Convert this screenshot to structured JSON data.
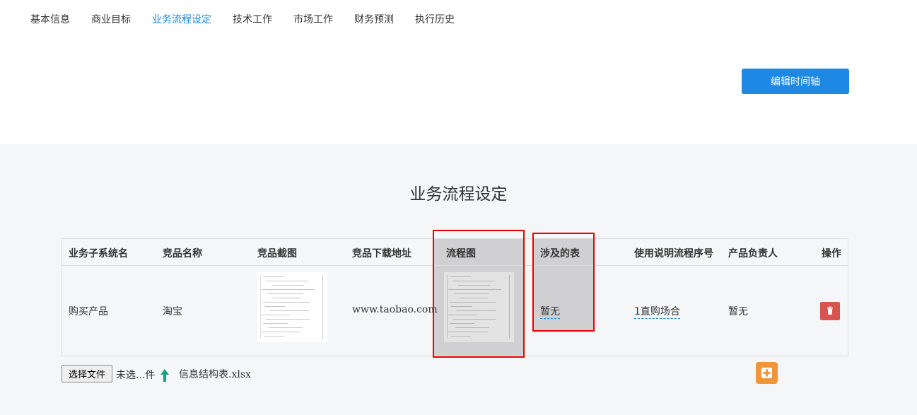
{
  "nav": {
    "tabs": [
      {
        "label": "基本信息"
      },
      {
        "label": "商业目标"
      },
      {
        "label": "业务流程设定",
        "active": true
      },
      {
        "label": "技术工作"
      },
      {
        "label": "市场工作"
      },
      {
        "label": "财务预测"
      },
      {
        "label": "执行历史"
      }
    ]
  },
  "toolbar": {
    "timeline_label": "编辑时间轴"
  },
  "section": {
    "title": "业务流程设定"
  },
  "table": {
    "headers": [
      "业务子系统名",
      "竞品名称",
      "竞品截图",
      "竞品下载地址",
      "流程图",
      "涉及的表",
      "使用说明流程序号",
      "产品负责人",
      "操作"
    ],
    "rows": [
      {
        "subsystem": "购买产品",
        "competitor": "淘宝",
        "download_url": "www.taobao.com",
        "tables": "暂无",
        "guide_sequence": "1直购场合",
        "owner": "暂无"
      }
    ]
  },
  "upload": {
    "button_label": "选择文件",
    "status": "未选...件",
    "file_name": "信息结构表.xlsx"
  },
  "colors": {
    "accent": "#1e88e5",
    "danger": "#d9534f",
    "add": "#f0953a",
    "highlight_box": "#ee0000"
  }
}
